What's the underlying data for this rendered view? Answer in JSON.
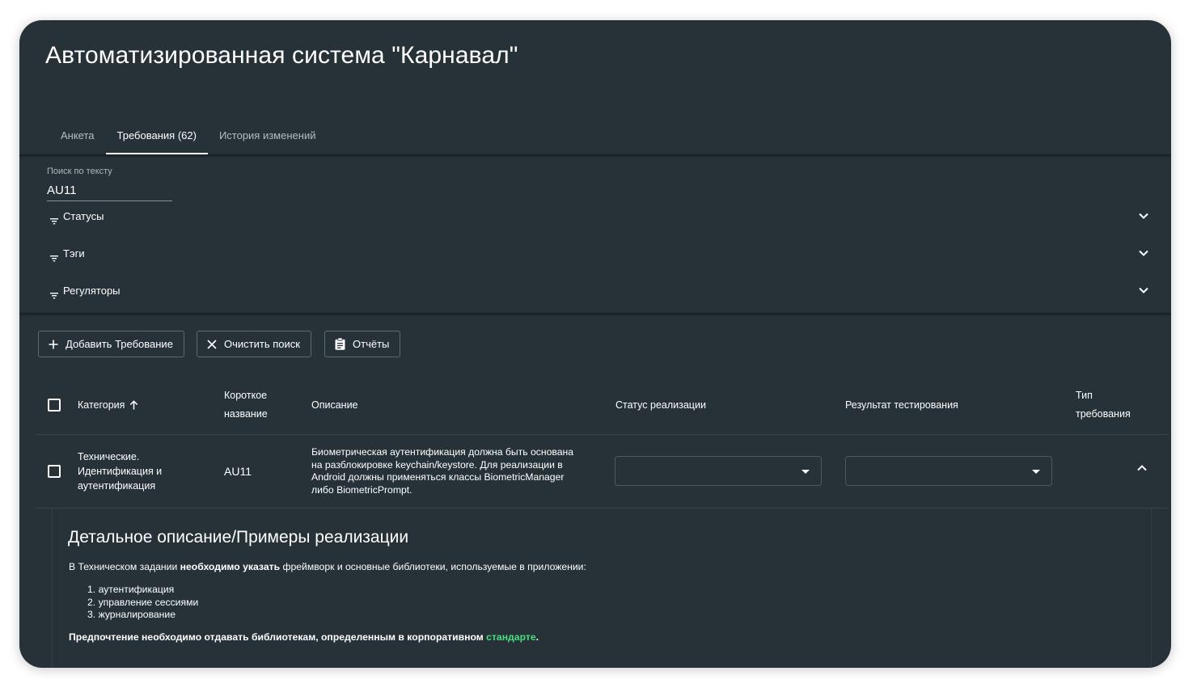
{
  "app": {
    "title": "Автоматизированная система \"Карнавал\""
  },
  "tabs": [
    {
      "label": "Анкета",
      "active": false
    },
    {
      "label": "Требования (62)",
      "active": true
    },
    {
      "label": "История изменений",
      "active": false
    }
  ],
  "search": {
    "label": "Поиск по тексту",
    "value": "AU11"
  },
  "filters": [
    {
      "label": "Статусы",
      "icon": "filter-icon",
      "expand_icon": "chevron-down-icon"
    },
    {
      "label": "Тэги",
      "icon": "filter-icon",
      "expand_icon": "chevron-down-icon"
    },
    {
      "label": "Регуляторы",
      "icon": "filter-icon",
      "expand_icon": "chevron-down-icon"
    }
  ],
  "actions": {
    "add": {
      "label": "Добавить Требование",
      "icon": "plus-icon"
    },
    "clear": {
      "label": "Очистить поиск",
      "icon": "close-icon"
    },
    "reports": {
      "label": "Отчёты",
      "icon": "clipboard-icon"
    }
  },
  "table": {
    "headers": {
      "category": "Категория",
      "short_name_line1": "Короткое",
      "short_name_line2": "название",
      "description": "Описание",
      "impl_status": "Статус реализации",
      "test_result": "Результат тестирования",
      "type_line1": "Тип",
      "type_line2": "требования"
    },
    "sort_icon": "arrow-up-icon",
    "rows": [
      {
        "category_lines": [
          "Технические.",
          "Идентификация и",
          "аутентификация"
        ],
        "short_name": "AU11",
        "description_lines": [
          "Биометрическая аутентификация должна быть основана",
          "на разблокировке keychain/keystore. Для реализации в",
          "Android должны применяться классы BiometricManager",
          "либо BiometricPrompt."
        ],
        "impl_status": "",
        "test_result": "",
        "type": "",
        "expanded": true,
        "collapse_icon": "chevron-up-icon"
      }
    ]
  },
  "detail": {
    "title": "Детальное описание/Примеры реализации",
    "p1_prefix": "В Техническом задании ",
    "p1_bold": "необходимо указать",
    "p1_suffix": " фреймворк и основные библиотеки, используемые в приложении:",
    "list": [
      "аутентификация",
      "управление сессиями",
      "журналирование"
    ],
    "p2_text": "Предпочтение необходимо отдавать библиотекам, определенным в корпоративном ",
    "p2_link": "стандарте",
    "p2_end": ".",
    "link_color": "#4ade80"
  },
  "colors": {
    "background": "#263238",
    "text": "#ffffff",
    "muted": "#b6bcc0"
  }
}
